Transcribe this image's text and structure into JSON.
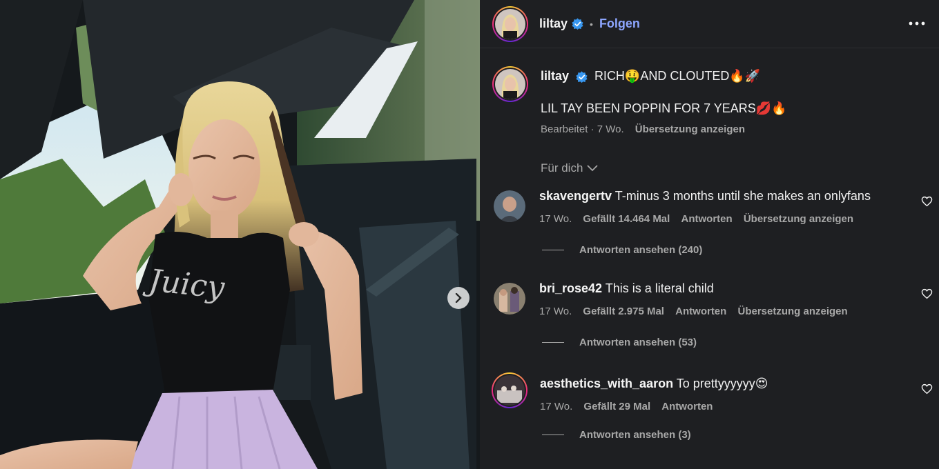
{
  "header": {
    "username": "liltay",
    "separator": "•",
    "follow_label": "Folgen"
  },
  "caption": {
    "username": "liltay",
    "text_line1": "RICH🤑AND CLOUTED🔥🚀",
    "text_line2": "LIL TAY BEEN POPPIN FOR 7 YEARS💋🔥",
    "edited": "Bearbeitet · 7 Wo.",
    "translate": "Übersetzung anzeigen"
  },
  "filter": {
    "label": "Für dich"
  },
  "comments": [
    {
      "username": "skavengertv",
      "text": "T-minus 3 months until she makes an onlyfans",
      "time": "17 Wo.",
      "likes": "Gefällt 14.464 Mal",
      "reply": "Antworten",
      "translate": "Übersetzung anzeigen",
      "view_replies": "Antworten ansehen (240)"
    },
    {
      "username": "bri_rose42",
      "text": "This is a literal child",
      "time": "17 Wo.",
      "likes": "Gefällt 2.975 Mal",
      "reply": "Antworten",
      "translate": "Übersetzung anzeigen",
      "view_replies": "Antworten ansehen (53)"
    },
    {
      "username": "aesthetics_with_aaron",
      "text": "To prettyyyyyy😍",
      "time": "17 Wo.",
      "likes": "Gefällt 29 Mal",
      "reply": "Antworten",
      "view_replies": "Antworten ansehen (3)"
    }
  ],
  "icons": {
    "verified": "verified-badge-icon",
    "more": "more-options-icon",
    "next": "chevron-right-icon",
    "heart": "heart-outline-icon",
    "filter_chevron": "chevron-down-icon"
  },
  "colors": {
    "panel_bg": "#1e1f22",
    "follow": "#8da6ff",
    "verified": "#3897f0",
    "muted": "#a8a8a8"
  }
}
